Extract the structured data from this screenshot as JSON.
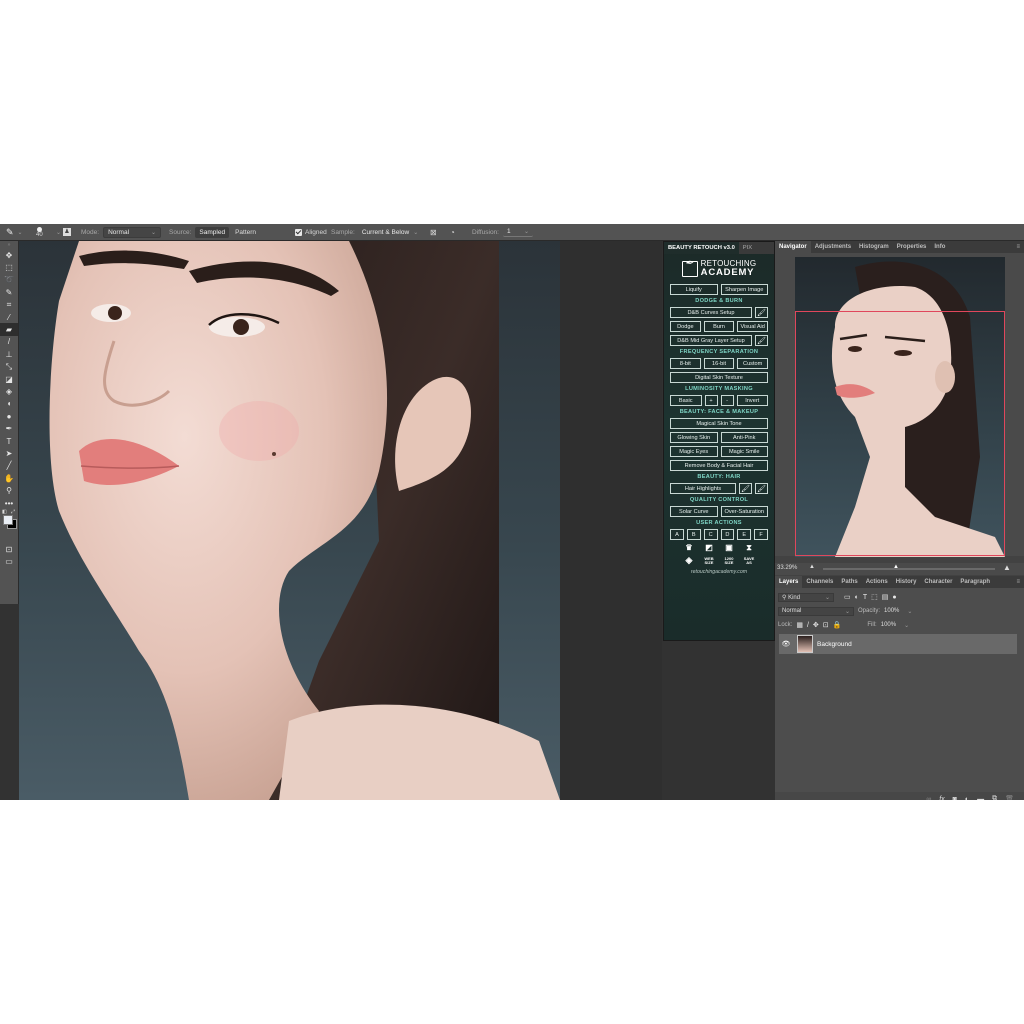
{
  "options_bar": {
    "brush_size": "40",
    "mode_label": "Mode:",
    "mode_value": "Normal",
    "source_label": "Source:",
    "source_sampled": "Sampled",
    "source_pattern": "Pattern",
    "aligned_label": "Aligned",
    "aligned_checked": true,
    "sample_label": "Sample:",
    "sample_value": "Current & Below",
    "diffusion_label": "Diffusion:",
    "diffusion_value": "1"
  },
  "toolbar": {
    "tools": [
      {
        "name": "move",
        "glyph": "✥"
      },
      {
        "name": "marquee",
        "glyph": "⬚"
      },
      {
        "name": "lasso",
        "glyph": "➰"
      },
      {
        "name": "quick-select",
        "glyph": "✎"
      },
      {
        "name": "crop",
        "glyph": "⌗"
      },
      {
        "name": "eyedropper",
        "glyph": "⁄"
      },
      {
        "name": "healing-brush",
        "glyph": "▰",
        "active": true
      },
      {
        "name": "brush",
        "glyph": "/"
      },
      {
        "name": "clone-stamp",
        "glyph": "⊥"
      },
      {
        "name": "history-brush",
        "glyph": "⤡"
      },
      {
        "name": "eraser",
        "glyph": "◪"
      },
      {
        "name": "paint-bucket",
        "glyph": "◈"
      },
      {
        "name": "blur",
        "glyph": "◖"
      },
      {
        "name": "dodge",
        "glyph": "●"
      },
      {
        "name": "pen",
        "glyph": "✒"
      },
      {
        "name": "type",
        "glyph": "T"
      },
      {
        "name": "path-select",
        "glyph": "➤"
      },
      {
        "name": "line",
        "glyph": "╱"
      },
      {
        "name": "hand",
        "glyph": "✋"
      },
      {
        "name": "zoom",
        "glyph": "⚲"
      },
      {
        "name": "more",
        "glyph": "•••"
      }
    ]
  },
  "plugin": {
    "tab_active": "BEAUTY RETOUCH v3.0",
    "tab_other": "PIX",
    "logo_line1": "RETOUCHING",
    "logo_line2": "ACADEMY",
    "row1": [
      "Liquify",
      "Sharpen Image"
    ],
    "sec_dodge": "DODGE & BURN",
    "dodge_curves": "D&B Curves Setup",
    "dodge_row": [
      "Dodge",
      "Burn",
      "Visual Aid"
    ],
    "dodge_midgray": "D&B Mid Gray Layer Setup",
    "sec_freq": "FREQUENCY SEPARATION",
    "freq_row": [
      "8-bit",
      "16-bit",
      "Custom"
    ],
    "digital_skin": "Digital Skin Texture",
    "sec_lum": "LUMINOSITY MASKING",
    "lum_row": [
      "Basic",
      "+",
      "-",
      "Invert"
    ],
    "sec_face": "BEAUTY: FACE & MAKEUP",
    "magical_skin": "Magical Skin Tone",
    "face_row1": [
      "Glowing Skin",
      "Anti-Pink"
    ],
    "face_row2": [
      "Magic Eyes",
      "Magic Smile"
    ],
    "remove_hair": "Remove Body & Facial Hair",
    "sec_hair": "BEAUTY: HAIR",
    "hair_highlights": "Hair Highlights",
    "sec_qc": "QUALITY CONTROL",
    "qc_row": [
      "Solar Curve",
      "Over-Saturation"
    ],
    "sec_user": "USER ACTIONS",
    "user_actions": [
      "A",
      "B",
      "C",
      "D",
      "E",
      "F"
    ],
    "icon_row2": [
      "WEB SIZE",
      "1200 SIZE",
      "SAVE AS"
    ],
    "url": "retouchingacademy.com"
  },
  "navigator": {
    "tabs": [
      "Navigator",
      "Adjustments",
      "Histogram",
      "Properties",
      "Info"
    ],
    "active_tab": "Navigator",
    "zoom_percent": "33.29%",
    "view_box_color": "#e0475c"
  },
  "layers": {
    "tabs": [
      "Layers",
      "Channels",
      "Paths",
      "Actions",
      "History",
      "Character",
      "Paragraph"
    ],
    "active_tab": "Layers",
    "filter_kind": "Kind",
    "blend_mode": "Normal",
    "opacity_label": "Opacity:",
    "opacity_value": "100%",
    "lock_label": "Lock:",
    "fill_label": "Fill:",
    "fill_value": "100%",
    "items": [
      {
        "name": "Background",
        "visible": true
      }
    ]
  }
}
